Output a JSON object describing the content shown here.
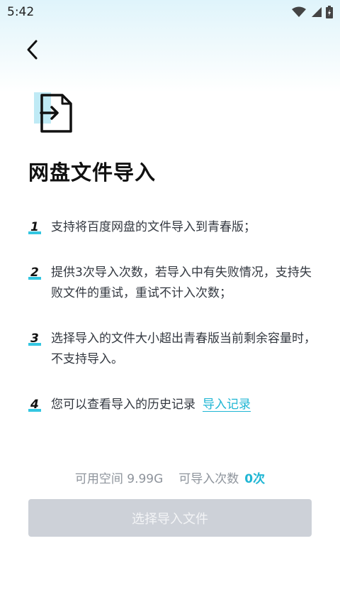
{
  "status_bar": {
    "time": "5:42",
    "icons": [
      "wifi-icon",
      "signal-icon",
      "battery-icon"
    ]
  },
  "header": {
    "back_icon": "chevron-left-icon"
  },
  "page": {
    "icon": "file-import-icon",
    "title": "网盘文件导入"
  },
  "rules": [
    {
      "num": "1",
      "text": "支持将百度网盘的文件导入到青春版；"
    },
    {
      "num": "2",
      "text": "提供3次导入次数，若导入中有失败情况，支持失败文件的重试，重试不计入次数；"
    },
    {
      "num": "3",
      "text": "选择导入的文件大小超出青春版当前剩余容量时，不支持导入。"
    },
    {
      "num": "4",
      "text": "您可以查看导入的历史记录",
      "link": "导入记录"
    }
  ],
  "stats": {
    "space_label": "可用空间 9.99G",
    "import_label": "可导入次数",
    "import_count": "0次"
  },
  "action": {
    "select_label": "选择导入文件"
  },
  "colors": {
    "accent": "#1fb6d4",
    "accent_bar": "#33c6e1",
    "button_disabled": "#cdd1d8"
  }
}
